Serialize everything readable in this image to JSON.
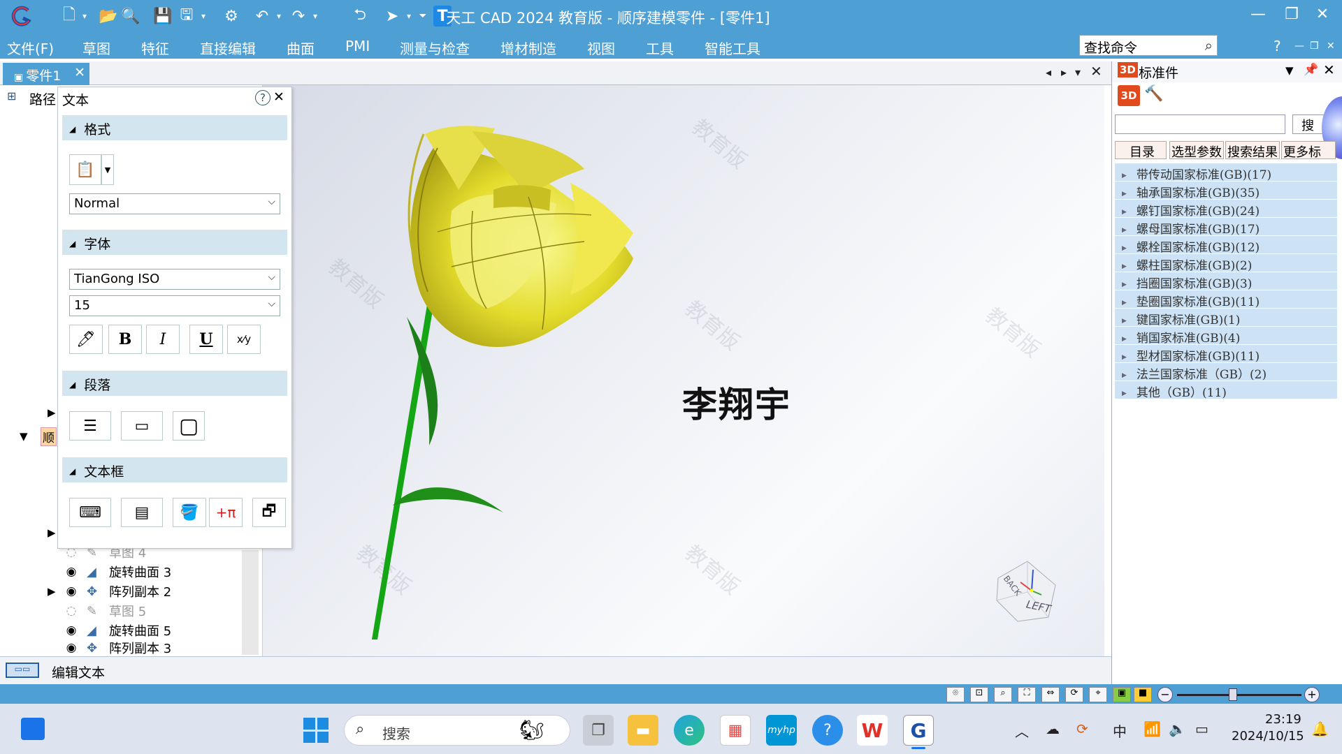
{
  "app": {
    "title": "天工 CAD 2024 教育版 - 顺序建模零件 - [零件1]"
  },
  "menu": [
    "文件(F)",
    "草图",
    "特征",
    "直接编辑",
    "曲面",
    "PMI",
    "测量与检查",
    "增材制造",
    "视图",
    "工具",
    "智能工具"
  ],
  "search_command": {
    "placeholder": "查找命令"
  },
  "help": "?",
  "doc_tab": {
    "label": "零件1",
    "close": "✕"
  },
  "left_tree": {
    "path_label": "路径",
    "seq_label": "顺",
    "items": [
      {
        "label": "草图 4",
        "dim": true
      },
      {
        "label": "旋转曲面 3",
        "dim": false
      },
      {
        "label": "阵列副本 2",
        "dim": false
      },
      {
        "label": "草图 5",
        "dim": true
      },
      {
        "label": "旋转曲面 5",
        "dim": false
      },
      {
        "label": "阵列副本 3",
        "dim": false
      }
    ]
  },
  "text_dialog": {
    "title": "文本",
    "help": "?",
    "close": "✕",
    "sections": {
      "format": "格式",
      "font": "字体",
      "paragraph": "段落",
      "textbox": "文本框"
    },
    "style_value": "Normal",
    "font_value": "TianGong ISO",
    "size_value": "15",
    "bold": "B",
    "italic": "I",
    "underline": "U"
  },
  "canvas": {
    "text": "李翔宇",
    "watermark": "教育版",
    "cube_back": "BACK",
    "cube_left": "LEFT"
  },
  "statusbar": {
    "prompt": "编辑文本"
  },
  "std_panel": {
    "title": "标准件",
    "search_button": "搜",
    "tabs": [
      "目录",
      "选型参数",
      "搜索结果",
      "更多标"
    ],
    "items": [
      "带传动国家标准(GB)(17)",
      "轴承国家标准(GB)(35)",
      "螺钉国家标准(GB)(24)",
      "螺母国家标准(GB)(17)",
      "螺栓国家标准(GB)(12)",
      "螺柱国家标准(GB)(2)",
      "挡圈国家标准(GB)(3)",
      "垫圈国家标准(GB)(11)",
      "键国家标准(GB)(1)",
      "销国家标准(GB)(4)",
      "型材国家标准(GB)(11)",
      "法兰国家标准（GB）(2)",
      "其他（GB）(11)"
    ]
  },
  "taskbar": {
    "search_placeholder": "搜索",
    "ime": "中",
    "time": "23:19",
    "date": "2024/10/15",
    "hp_label": "myhp"
  }
}
